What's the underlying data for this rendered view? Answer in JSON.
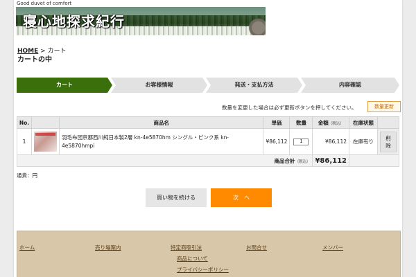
{
  "header": {
    "tagline": "Good duvet of comfort",
    "site_title": "寝心地探求紀行"
  },
  "breadcrumb": {
    "home": "HOME",
    "separator": ">",
    "current": "カート"
  },
  "page_title": "カートの中",
  "steps": [
    "カート",
    "お客様情報",
    "発送・支払方法",
    "内容確認"
  ],
  "notice": "数量を変更した場合は必ず更新ボタンを押してください。",
  "update_button": "数量更新",
  "table": {
    "headers": {
      "no": "No.",
      "image": "",
      "name": "商品名",
      "price": "単価",
      "qty": "数量",
      "amount": "金額",
      "amount_note": "（税込）",
      "stock": "在庫状態",
      "action": ""
    },
    "rows": [
      {
        "no": "1",
        "name": "羽毛布団京都西川純日本製2層 kn-4e5870hm シングル・ピンク系 kn-4e5870hmpi",
        "price": "¥86,112",
        "qty": "1",
        "amount": "¥86,112",
        "stock": "在庫有り",
        "delete": "削除"
      }
    ],
    "total_label": "商品合計",
    "total_note": "（税込）",
    "total_value": "¥86,112"
  },
  "currency_line": "通貨：円",
  "buttons": {
    "continue": "買い物を続ける",
    "next": "次　へ"
  },
  "footer_links": [
    "ホーム",
    "売り場案内",
    "特定商取引法",
    "お問合せ",
    "メンバー",
    "商品について",
    "プライバシーポリシー"
  ]
}
